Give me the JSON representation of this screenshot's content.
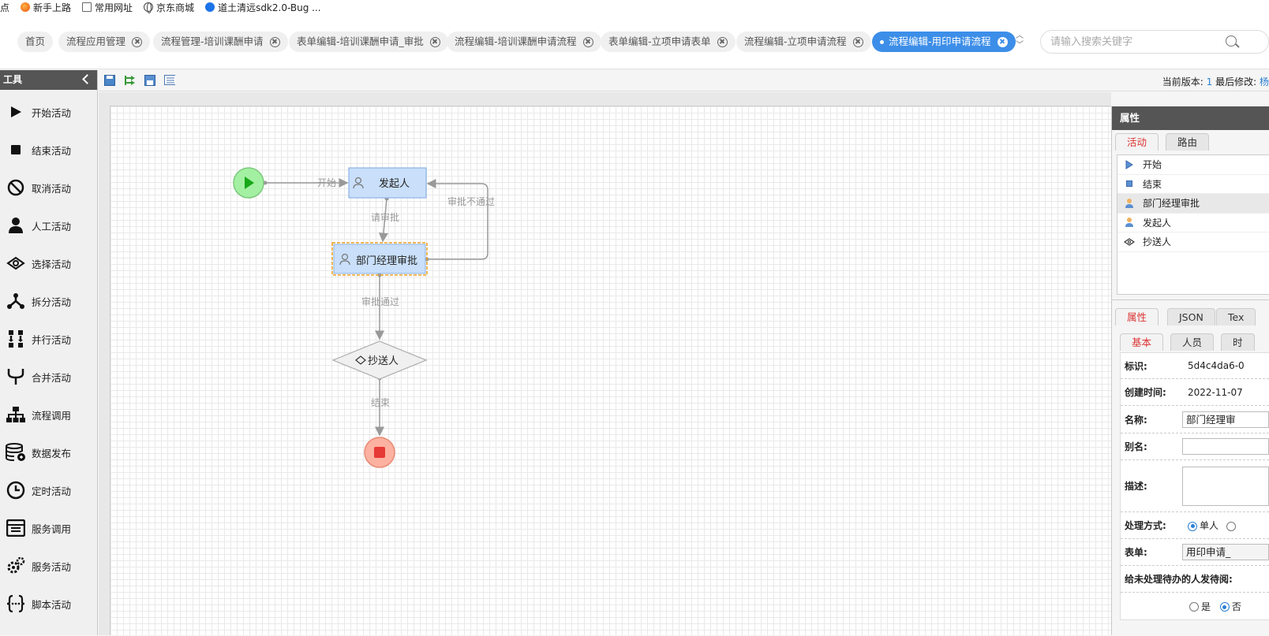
{
  "bookmarks": [
    {
      "label": "点"
    },
    {
      "label": "新手上路"
    },
    {
      "label": "常用网址"
    },
    {
      "label": "京东商城"
    },
    {
      "label": "道土清远sdk2.0-Bug ..."
    }
  ],
  "tabs": [
    {
      "label": "首页"
    },
    {
      "label": "流程应用管理"
    },
    {
      "label": "流程管理-培训课酬申请"
    },
    {
      "label": "表单编辑-培训课酬申请_审批"
    },
    {
      "label": "流程编辑-培训课酬申请流程"
    },
    {
      "label": "表单编辑-立项申请表单"
    },
    {
      "label": "流程编辑-立项申请流程"
    },
    {
      "label": "流程编辑-用印申请流程"
    }
  ],
  "search": {
    "placeholder": "请输入搜索关键字"
  },
  "tools": {
    "title": "工具",
    "items": [
      {
        "label": "开始活动",
        "icon": "play-icon"
      },
      {
        "label": "结束活动",
        "icon": "stop-icon"
      },
      {
        "label": "取消活动",
        "icon": "cancel-icon"
      },
      {
        "label": "人工活动",
        "icon": "user-icon"
      },
      {
        "label": "选择活动",
        "icon": "choice-icon"
      },
      {
        "label": "拆分活动",
        "icon": "split-icon"
      },
      {
        "label": "并行活动",
        "icon": "parallel-icon"
      },
      {
        "label": "合并活动",
        "icon": "merge-icon"
      },
      {
        "label": "流程调用",
        "icon": "org-chart-icon"
      },
      {
        "label": "数据发布",
        "icon": "database-icon"
      },
      {
        "label": "定时活动",
        "icon": "clock-icon"
      },
      {
        "label": "服务调用",
        "icon": "service-icon"
      },
      {
        "label": "服务活动",
        "icon": "gears-icon"
      },
      {
        "label": "脚本活动",
        "icon": "script-icon"
      }
    ]
  },
  "version": {
    "label": "当前版本:",
    "value": "1",
    "modified_label": "最后修改:",
    "modified_value": "杨"
  },
  "flow": {
    "nodes": {
      "initiator": "发起人",
      "manager": "部门经理审批",
      "cc": "抄送人"
    },
    "edges": {
      "start": "开始",
      "request": "请审批",
      "reject": "审批不通过",
      "approve": "审批通过",
      "end": "结束"
    }
  },
  "props": {
    "title": "属性",
    "top_tabs": [
      "活动",
      "路由"
    ],
    "activities": [
      {
        "label": "开始",
        "icon": "start-triangle-icon"
      },
      {
        "label": "结束",
        "icon": "end-square-icon"
      },
      {
        "label": "部门经理审批",
        "icon": "person-icon"
      },
      {
        "label": "发起人",
        "icon": "person-icon"
      },
      {
        "label": "抄送人",
        "icon": "cc-icon"
      }
    ],
    "mid_tabs": [
      "属性",
      "JSON",
      "Tex"
    ],
    "sub_tabs": [
      "基本",
      "人员",
      "时"
    ],
    "fields": {
      "id_label": "标识:",
      "id_value": "5d4c4da6-0",
      "created_label": "创建时间:",
      "created_value": "2022-11-07",
      "name_label": "名称:",
      "name_value": "部门经理审",
      "alias_label": "别名:",
      "alias_value": "",
      "desc_label": "描述:",
      "desc_value": "",
      "mode_label": "处理方式:",
      "mode_single": "单人",
      "form_label": "表单:",
      "form_value": "用印申请_",
      "notify_label": "给未处理待办的人发待阅:",
      "notify_yes": "是",
      "notify_no": "否"
    }
  }
}
